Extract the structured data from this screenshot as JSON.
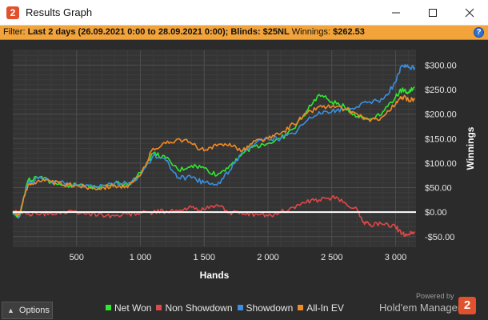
{
  "window": {
    "title": "Results Graph",
    "app_icon_glyph": "2"
  },
  "filter": {
    "label": "Filter:",
    "range": "Last 2 days (26.09.2021 0:00 to 28.09.2021 0:00);",
    "blinds": "Blinds: $25NL",
    "winnings_label": "Winnings:",
    "winnings_value": "$262.53",
    "help_glyph": "?"
  },
  "chart_data": {
    "type": "line",
    "xlabel": "Hands",
    "ylabel": "Winnings",
    "xlim": [
      0,
      3160
    ],
    "ylim": [
      -70,
      330
    ],
    "x_ticks": [
      500,
      1000,
      1500,
      2000,
      2500,
      3000
    ],
    "x_tick_labels": [
      "500",
      "1 000",
      "1 500",
      "2 000",
      "2 500",
      "3 000"
    ],
    "y_ticks": [
      -50,
      0,
      50,
      100,
      150,
      200,
      250,
      300
    ],
    "y_tick_labels": [
      "-$50.00",
      "$0.00",
      "$50.00",
      "$100.00",
      "$150.00",
      "$200.00",
      "$250.00",
      "$300.00"
    ],
    "grid": true,
    "zero_line": true,
    "series": [
      {
        "name": "Net Won",
        "color": "#2ee82e",
        "x": [
          0,
          50,
          120,
          200,
          300,
          400,
          500,
          600,
          700,
          800,
          900,
          1000,
          1100,
          1200,
          1300,
          1400,
          1500,
          1600,
          1700,
          1800,
          1900,
          2000,
          2100,
          2200,
          2300,
          2400,
          2500,
          2600,
          2700,
          2800,
          2900,
          3000,
          3050,
          3100,
          3150
        ],
        "values": [
          0,
          -10,
          65,
          70,
          62,
          55,
          55,
          50,
          55,
          60,
          55,
          80,
          120,
          110,
          85,
          95,
          90,
          75,
          95,
          120,
          135,
          140,
          150,
          170,
          205,
          240,
          225,
          215,
          195,
          190,
          205,
          235,
          250,
          245,
          255
        ]
      },
      {
        "name": "Non Showdown",
        "color": "#e04848",
        "x": [
          0,
          100,
          200,
          300,
          400,
          500,
          600,
          700,
          800,
          900,
          1000,
          1100,
          1200,
          1300,
          1400,
          1500,
          1600,
          1700,
          1800,
          1900,
          2000,
          2100,
          2200,
          2300,
          2400,
          2500,
          2600,
          2700,
          2750,
          2800,
          2900,
          3000,
          3050,
          3100,
          3150
        ],
        "values": [
          0,
          -2,
          -5,
          -2,
          -1,
          0,
          -4,
          -5,
          -8,
          -4,
          -2,
          0,
          2,
          1,
          10,
          5,
          15,
          0,
          -5,
          -4,
          -8,
          0,
          10,
          20,
          25,
          30,
          20,
          5,
          -20,
          -25,
          -25,
          -30,
          -45,
          -45,
          -40
        ]
      },
      {
        "name": "Showdown",
        "color": "#3a8fe0",
        "x": [
          0,
          50,
          120,
          200,
          300,
          400,
          500,
          600,
          700,
          800,
          900,
          1000,
          1100,
          1200,
          1300,
          1400,
          1500,
          1600,
          1700,
          1800,
          1900,
          2000,
          2100,
          2200,
          2300,
          2400,
          2500,
          2600,
          2700,
          2800,
          2900,
          3000,
          3050,
          3100,
          3150
        ],
        "values": [
          0,
          -8,
          60,
          68,
          63,
          60,
          55,
          55,
          55,
          60,
          58,
          75,
          115,
          105,
          70,
          70,
          60,
          55,
          85,
          125,
          140,
          150,
          150,
          160,
          185,
          205,
          205,
          210,
          215,
          225,
          230,
          265,
          300,
          295,
          295
        ]
      },
      {
        "name": "All-In EV",
        "color": "#f08a24",
        "x": [
          0,
          50,
          120,
          200,
          300,
          400,
          500,
          600,
          700,
          800,
          900,
          1000,
          1100,
          1200,
          1300,
          1400,
          1500,
          1600,
          1700,
          1800,
          1900,
          2000,
          2100,
          2200,
          2300,
          2400,
          2500,
          2600,
          2700,
          2800,
          2900,
          3000,
          3050,
          3100,
          3150
        ],
        "values": [
          0,
          -5,
          55,
          65,
          62,
          55,
          55,
          50,
          50,
          55,
          50,
          75,
          130,
          140,
          150,
          140,
          125,
          135,
          140,
          125,
          145,
          150,
          160,
          180,
          200,
          215,
          215,
          210,
          200,
          185,
          195,
          220,
          235,
          230,
          230
        ]
      }
    ]
  },
  "bottom": {
    "options_label": "Options",
    "powered_by": "Powered by",
    "brand": "Hold'em Manager",
    "brand_badge": "2"
  }
}
